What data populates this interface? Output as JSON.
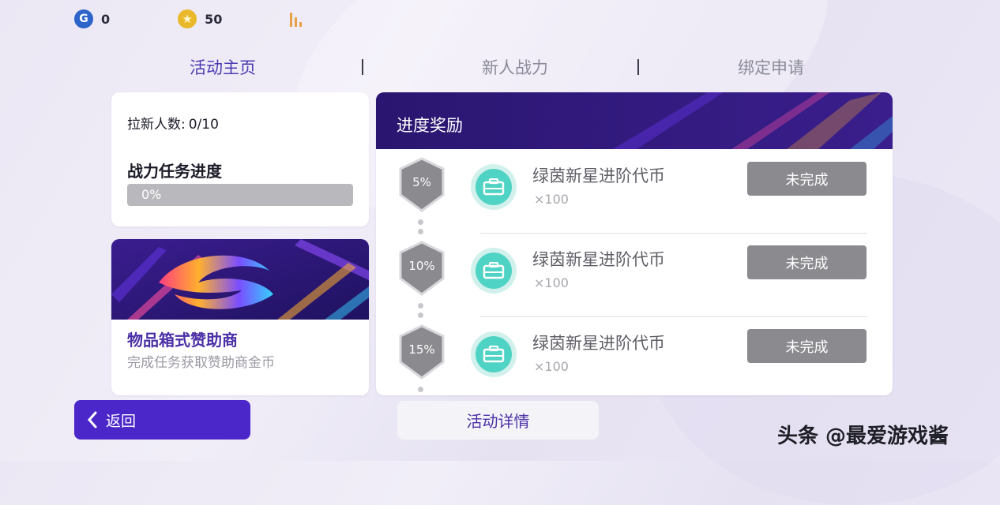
{
  "currency": {
    "g_icon_letter": "G",
    "g_value": "0",
    "star_icon": "★",
    "star_value": "50"
  },
  "tabs": [
    {
      "label": "活动主页",
      "active": true
    },
    {
      "label": "新人战力",
      "active": false
    },
    {
      "label": "绑定申请",
      "active": false
    }
  ],
  "stats": {
    "invite_label": "拉新人数:",
    "invite_value": "0/10",
    "power_title": "战力任务进度",
    "progress_text": "0%",
    "progress_fraction": 0
  },
  "sponsor": {
    "title": "物品箱式赞助商",
    "subtitle": "完成任务获取赞助商金币"
  },
  "rewards": {
    "title": "进度奖励",
    "rows": [
      {
        "percent": "5%",
        "name": "绿茵新星进阶代币",
        "qty": "×100",
        "status": "未完成"
      },
      {
        "percent": "10%",
        "name": "绿茵新星进阶代币",
        "qty": "×100",
        "status": "未完成"
      },
      {
        "percent": "15%",
        "name": "绿茵新星进阶代币",
        "qty": "×100",
        "status": "未完成"
      }
    ]
  },
  "buttons": {
    "back": "返回",
    "details": "活动详情"
  },
  "watermark": "头条 @最爱游戏酱",
  "colors": {
    "accent": "#4b26c8",
    "tab_active": "#4b3bb2",
    "status_button": "#8a8a8f",
    "token_icon": "#4fd3c4"
  }
}
